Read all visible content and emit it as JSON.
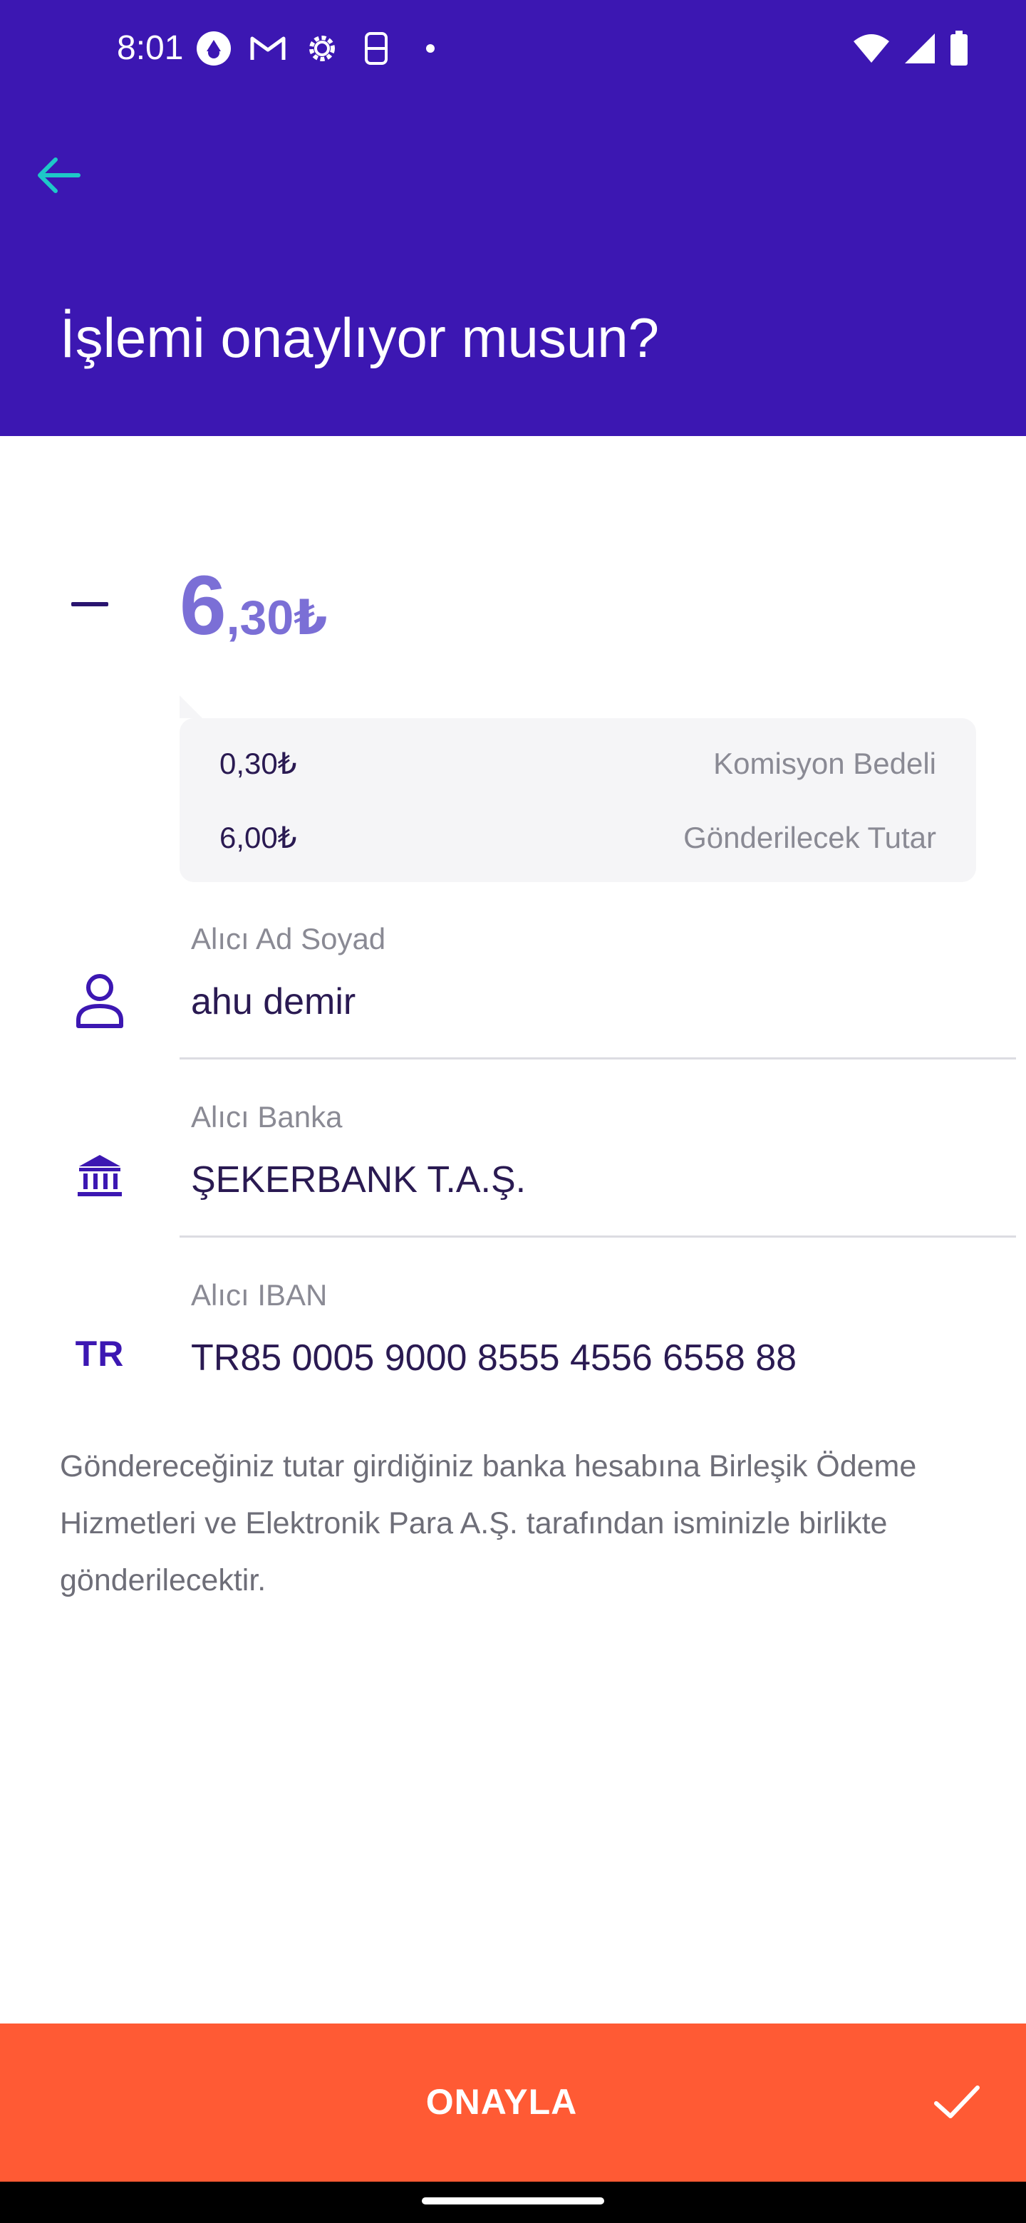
{
  "status_bar": {
    "time": "8:01"
  },
  "header": {
    "title": "İşlemi onaylıyor musun?"
  },
  "amount": {
    "sign": "−",
    "integer": "6",
    "decimal": ",30₺"
  },
  "breakdown": [
    {
      "value": "0,30₺",
      "label": "Komisyon Bedeli"
    },
    {
      "value": "6,00₺",
      "label": "Gönderilecek Tutar"
    }
  ],
  "fields": {
    "name": {
      "label": "Alıcı Ad Soyad",
      "value": "ahu demir"
    },
    "bank": {
      "label": "Alıcı Banka",
      "value": "ŞEKERBANK T.A.Ş."
    },
    "iban": {
      "label": "Alıcı IBAN",
      "value": "TR85 0005 9000 8555 4556 6558 88",
      "icon_text": "TR"
    }
  },
  "info_text": "Göndereceğiniz tutar girdiğiniz banka hesabına Birleşik Ödeme Hizmetleri ve Elektronik Para A.Ş. tarafından isminizle birlikte gönderilecektir.",
  "confirm_button": {
    "label": "ONAYLA"
  },
  "colors": {
    "header_bg": "#3c17b2",
    "back_arrow": "#1ec8c8",
    "accent_purple": "#3c17b2",
    "amount_color": "#7b6fd6",
    "confirm_bg": "#ff5a34"
  },
  "icons": {
    "back": "arrow-left-icon",
    "name": "person-icon",
    "bank": "bank-icon",
    "confirm": "check-icon"
  }
}
